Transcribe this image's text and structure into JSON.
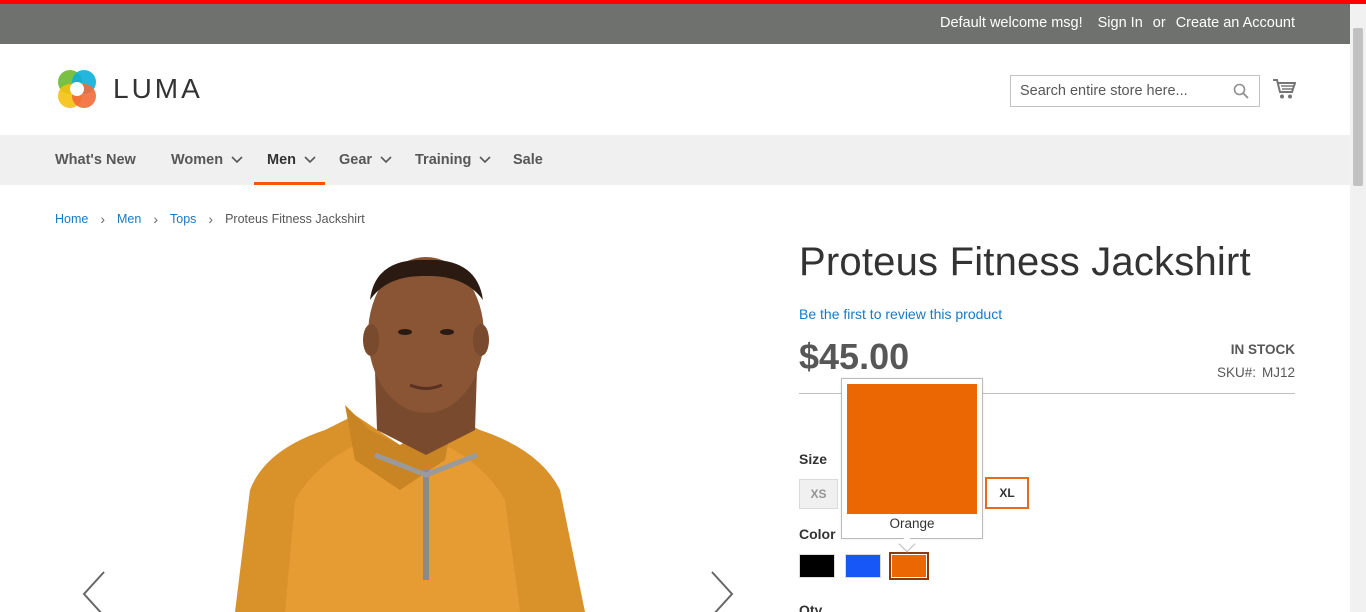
{
  "header": {
    "welcome": "Default welcome msg!",
    "sign_in": "Sign In",
    "or": "or",
    "create_account": "Create an Account",
    "accent_color": "#ff0000",
    "panel_bg": "#6e716e"
  },
  "logo": {
    "text": "LUMA"
  },
  "search": {
    "placeholder": "Search entire store here...",
    "icon": "search-icon"
  },
  "cart": {
    "icon": "cart-icon"
  },
  "nav": {
    "items": [
      {
        "label": "What's New",
        "has_dropdown": false
      },
      {
        "label": "Women",
        "has_dropdown": true
      },
      {
        "label": "Men",
        "has_dropdown": true,
        "active": true
      },
      {
        "label": "Gear",
        "has_dropdown": true
      },
      {
        "label": "Training",
        "has_dropdown": true
      },
      {
        "label": "Sale",
        "has_dropdown": false
      }
    ],
    "active_color": "#ff5501"
  },
  "breadcrumb": {
    "items": [
      "Home",
      "Men",
      "Tops"
    ],
    "current": "Proteus Fitness Jackshirt"
  },
  "product": {
    "title": "Proteus Fitness Jackshirt",
    "review_link": "Be the first to review this product",
    "price": "$45.00",
    "stock": "IN STOCK",
    "sku_label": "SKU#:",
    "sku_value": "MJ12",
    "size_label": "Size",
    "sizes": [
      "XS",
      "XL"
    ],
    "color_label": "Color",
    "colors": [
      {
        "name": "Black",
        "hex": "#000000"
      },
      {
        "name": "Blue",
        "hex": "#1857f7"
      },
      {
        "name": "Orange",
        "hex": "#eb6703",
        "selected": true
      }
    ],
    "qty_label": "Qty"
  },
  "tooltip": {
    "label": "Orange",
    "color": "#eb6703"
  }
}
